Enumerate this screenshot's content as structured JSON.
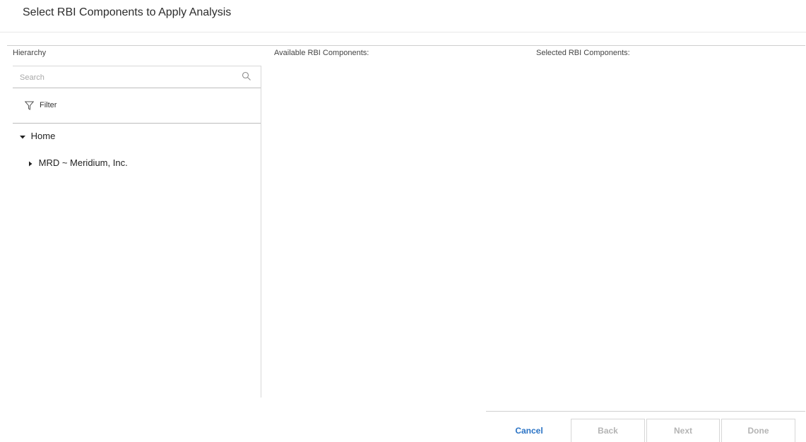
{
  "dialog": {
    "title": "Select RBI Components to Apply Analysis"
  },
  "columns": {
    "hierarchy": "Hierarchy",
    "available": "Available RBI Components:",
    "selected": "Selected RBI Components:"
  },
  "search": {
    "placeholder": "Search",
    "value": ""
  },
  "filter": {
    "label": "Filter"
  },
  "tree": {
    "nodes": [
      {
        "label": "Home",
        "state": "expanded"
      },
      {
        "label": "MRD ~ Meridium, Inc.",
        "state": "collapsed"
      }
    ]
  },
  "footer": {
    "cancel_label": "Cancel",
    "back_label": "Back",
    "next_label": "Next",
    "done_label": "Done"
  },
  "colors": {
    "link_blue": "#2a73c5",
    "disabled_text": "#b4b4b4",
    "border": "#d6d6d6"
  },
  "icons": [
    "search-icon",
    "filter-icon",
    "caret-down-icon",
    "caret-right-icon"
  ]
}
